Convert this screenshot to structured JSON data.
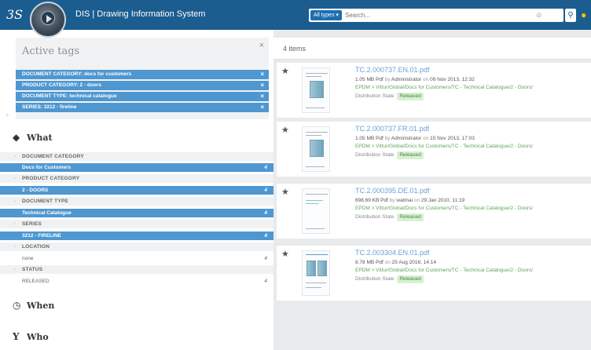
{
  "header": {
    "logo": "3S",
    "title": "DIS | Drawing Information System",
    "types_label": "All types ▾",
    "search_placeholder": "Search..."
  },
  "active_tags": {
    "title": "Active tags",
    "tags": [
      "DOCUMENT CATEGORY: docs for customers",
      "PRODUCT CATEGORY: 2 - doors",
      "DOCUMENT TYPE: technical catalogue",
      "SERIES: 3212 - fireline"
    ]
  },
  "what": {
    "title": "What",
    "facets": [
      {
        "category": "DOCUMENT CATEGORY",
        "value": "Docs for Customers",
        "count": "4"
      },
      {
        "category": "PRODUCT CATEGORY",
        "value": "2 - DOORS",
        "count": "4"
      },
      {
        "category": "DOCUMENT TYPE",
        "value": "Technical Catalogue",
        "count": "4"
      },
      {
        "category": "SERIES",
        "value": "3212 - FIRELINE",
        "count": "4"
      }
    ],
    "location": {
      "label": "LOCATION",
      "value": "none",
      "count": "4"
    },
    "status": {
      "label": "STATUS",
      "value": "RELEASED",
      "count": "4"
    }
  },
  "when": {
    "title": "When"
  },
  "who": {
    "title": "Who"
  },
  "results": {
    "count_label": "4 items",
    "items": [
      {
        "filename": "TC.2.000737.EN.01.pdf",
        "size": "1.05 MB Pdf",
        "by": "by",
        "owner": "Administrator",
        "on": "on",
        "date": "09 Nov 2013, 12:32",
        "path": "EPDM > Vittur/Global/Docs for Customers/TC - Technical Catalogue/2 - Doors/",
        "state_label": "Distribution State",
        "state": "Released"
      },
      {
        "filename": "TC.2.000737.FR.01.pdf",
        "size": "1.05 MB Pdf",
        "by": "by",
        "owner": "Administrator",
        "on": "on",
        "date": "15 Nov 2013, 17:03",
        "path": "EPDM > Vittur/Global/Docs for Customers/TC - Technical Catalogue/2 - Doors/",
        "state_label": "Distribution State",
        "state": "Released"
      },
      {
        "filename": "TC.2.000395.DE.01.pdf",
        "size": "698.69 KB Pdf",
        "by": "by",
        "owner": "watmai",
        "on": "on",
        "date": "29 Jan 2010, 11:19",
        "path": "EPDM > Vittur/Global/Docs for Customers/TC - Technical Catalogue/2 - Doors/",
        "state_label": "Distribution State",
        "state": "Released"
      },
      {
        "filename": "TC.2.003304.EN.01.pdf",
        "size": "8.78 MB Pdf",
        "by": "",
        "owner": "",
        "on": "on",
        "date": "25 Aug 2016, 14:14",
        "path": "EPDM > Vittur/Global/Docs for Customers/TC - Technical Catalogue/2 - Doors/",
        "state_label": "Distribution State",
        "state": "Released"
      }
    ]
  },
  "icons": {
    "star": "star-icon",
    "close": "close-icon",
    "cube": "cube-icon",
    "clock": "clock-icon",
    "antenna": "antenna-icon",
    "bulb": "lightbulb-icon",
    "search": "search-icon"
  },
  "colors": {
    "header_bg": "#1b5d8f",
    "tag_bg": "#4e97d1",
    "released_bg": "#d9f0d3",
    "path_green": "#62a560",
    "link_blue": "#6aa0d8"
  }
}
